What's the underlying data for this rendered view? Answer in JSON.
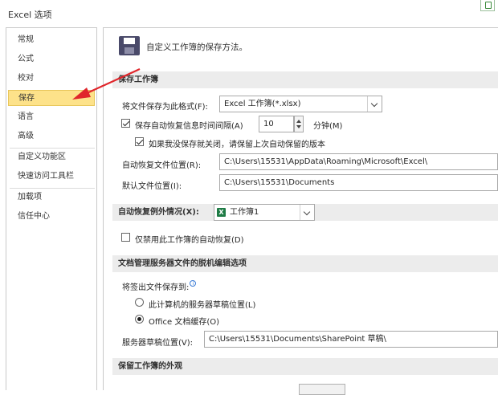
{
  "window": {
    "title": "Excel 选项"
  },
  "sidebar": {
    "items": [
      {
        "label": "常规"
      },
      {
        "label": "公式"
      },
      {
        "label": "校对"
      },
      {
        "label": "保存"
      },
      {
        "label": "语言"
      },
      {
        "label": "高级"
      },
      {
        "label": "自定义功能区"
      },
      {
        "label": "快速访问工具栏"
      },
      {
        "label": "加载项"
      },
      {
        "label": "信任中心"
      }
    ],
    "selected_index": 3
  },
  "main": {
    "heading": "自定义工作簿的保存方法。",
    "save_section": {
      "title": "保存工作簿",
      "format_label": "将文件保存为此格式(F):",
      "format_value": "Excel 工作簿(*.xlsx)",
      "autorecover_label": "保存自动恢复信息时间间隔(A)",
      "autorecover_checked": true,
      "interval_value": "10",
      "interval_unit": "分钟(M)",
      "keep_last_label": "如果我没保存就关闭，请保留上次自动保留的版本",
      "keep_last_checked": true,
      "autorecover_location_label": "自动恢复文件位置(R):",
      "autorecover_location_value": "C:\\Users\\15531\\AppData\\Roaming\\Microsoft\\Excel\\",
      "default_location_label": "默认文件位置(I):",
      "default_location_value": "C:\\Users\\15531\\Documents"
    },
    "exceptions_section": {
      "title": "自动恢复例外情况(X):",
      "workbook_value": "工作簿1",
      "disable_label": "仅禁用此工作簿的自动恢复(D)",
      "disable_checked": false
    },
    "offline_section": {
      "title": "文档管理服务器文件的脱机编辑选项",
      "save_checked_out_label": "将签出文件保存到:",
      "option_server_label": "此计算机的服务器草稿位置(L)",
      "option_office_label": "Office 文档缓存(O)",
      "selected_option": "office",
      "drafts_location_label": "服务器草稿位置(V):",
      "drafts_location_value": "C:\\Users\\15531\\Documents\\SharePoint 草稿\\"
    },
    "appearance_section": {
      "title": "保留工作簿的外观"
    }
  },
  "colors": {
    "selected_bg": "#fde28a",
    "section_bg": "#ececec",
    "annotation_arrow": "#e0262b",
    "excel_green": "#1e7b45"
  }
}
